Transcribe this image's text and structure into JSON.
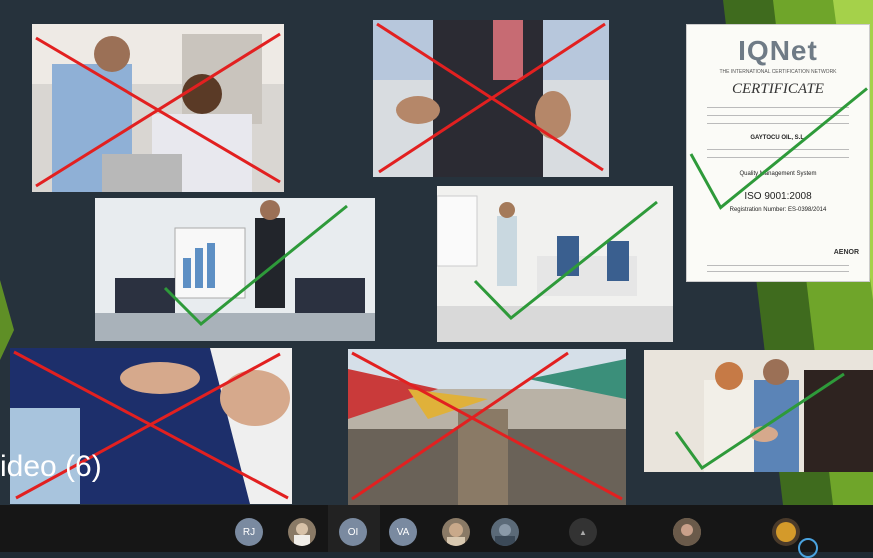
{
  "slide": {
    "caption": "ideo (6)",
    "certificate": {
      "logo": "IQNet",
      "network": "THE INTERNATIONAL CERTIFICATION NETWORK",
      "title": "CERTIFICATE",
      "company": "GAYTOCU OIL, S.L.",
      "management": "Quality Management System",
      "standard": "ISO 9001:2008",
      "registration": "Registration Number: ES-0398/2014",
      "issuer": "AENOR"
    }
  },
  "participants": [
    {
      "initials": "RJ"
    },
    {
      "initials": "OI"
    },
    {
      "initials": "VA"
    }
  ]
}
